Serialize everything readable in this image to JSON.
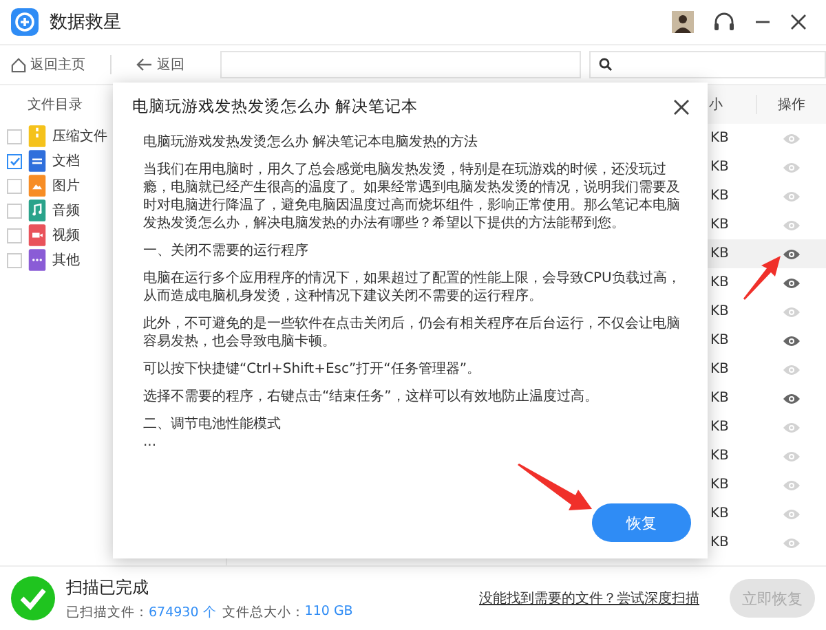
{
  "app": {
    "title": "数据救星"
  },
  "toolbar": {
    "home": "返回主页",
    "back": "返回"
  },
  "sidebar": {
    "header": "文件目录",
    "items": [
      {
        "label": "压缩文件",
        "kind": "archive",
        "color": "#f5c21b",
        "checked": false
      },
      {
        "label": "文档",
        "kind": "document",
        "color": "#2f6fdc",
        "checked": true
      },
      {
        "label": "图片",
        "kind": "image",
        "color": "#f78d25",
        "checked": false
      },
      {
        "label": "音频",
        "kind": "audio",
        "color": "#2aa38b",
        "checked": false
      },
      {
        "label": "视频",
        "kind": "video",
        "color": "#e9535b",
        "checked": false
      },
      {
        "label": "其他",
        "kind": "other",
        "color": "#8a5cd6",
        "checked": false
      }
    ]
  },
  "table": {
    "columns": [
      "小",
      "操作"
    ],
    "rows": [
      {
        "size": "KB",
        "preview_enabled": false,
        "selected": false
      },
      {
        "size": "KB",
        "preview_enabled": false,
        "selected": false
      },
      {
        "size": "KB",
        "preview_enabled": false,
        "selected": false
      },
      {
        "size": "KB",
        "preview_enabled": false,
        "selected": false
      },
      {
        "size": "KB",
        "preview_enabled": true,
        "selected": true
      },
      {
        "size": "KB",
        "preview_enabled": true,
        "selected": false
      },
      {
        "size": "KB",
        "preview_enabled": false,
        "selected": false
      },
      {
        "size": "KB",
        "preview_enabled": true,
        "selected": false
      },
      {
        "size": "KB",
        "preview_enabled": false,
        "selected": false
      },
      {
        "size": "KB",
        "preview_enabled": true,
        "selected": false
      },
      {
        "size": "KB",
        "preview_enabled": false,
        "selected": false
      },
      {
        "size": "KB",
        "preview_enabled": false,
        "selected": false
      },
      {
        "size": "KB",
        "preview_enabled": false,
        "selected": false
      },
      {
        "size": "KB",
        "preview_enabled": false,
        "selected": false
      },
      {
        "size": "KB",
        "preview_enabled": false,
        "selected": false
      }
    ]
  },
  "dialog": {
    "title": "电脑玩游戏发热发烫怎么办 解决笔记本",
    "paragraphs": [
      "电脑玩游戏发热发烫怎么办 解决笔记本电脑发热的方法",
      "当我们在用电脑时，用久了总会感觉电脑发热发烫，特别是在玩游戏的时候，还没玩过瘾，电脑就已经产生很高的温度了。如果经常遇到电脑发热发烫的情况，说明我们需要及时对电脑进行降温了，避免电脑因温度过高而烧坏组件，影响正常使用。那么笔记本电脑发热发烫怎么办，解决电脑发热的办法有哪些？希望以下提供的方法能帮到您。",
      "一、关闭不需要的运行程序",
      "电脑在运行多个应用程序的情况下，如果超过了配置的性能上限，会导致CPU负载过高，从而造成电脑机身发烫，这种情况下建议关闭不需要的运行程序。",
      "此外，不可避免的是一些软件在点击关闭后，仍会有相关程序在后台运行，不仅会让电脑容易发热，也会导致电脑卡顿。",
      "可以按下快捷键“Ctrl+Shift+Esc”打开“任务管理器”。",
      "选择不需要的程序，右键点击“结束任务”，这样可以有效地防止温度过高。",
      "二、调节电池性能模式\n..."
    ],
    "button": "恢复"
  },
  "status": {
    "title": "扫描已完成",
    "scanned_label": "已扫描文件：",
    "scanned_count": "674930 个",
    "size_label": "文件总大小：",
    "size_value": "110 GB",
    "link": "没能找到需要的文件？尝试深度扫描",
    "button": "立即恢复",
    "button_disabled": true
  }
}
